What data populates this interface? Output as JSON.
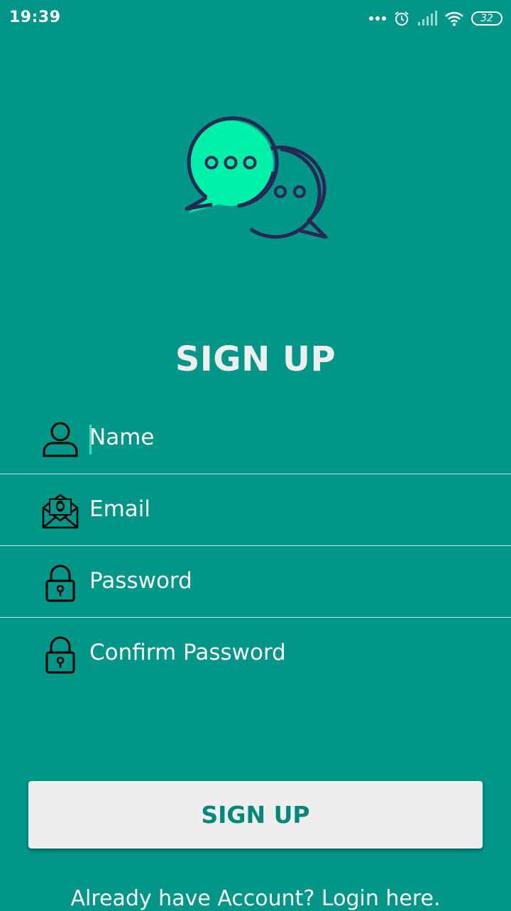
{
  "status_bar": {
    "time": "19:39",
    "battery": "32",
    "icons": [
      "more-dots-icon",
      "alarm-icon",
      "signal-icon",
      "wifi-icon",
      "battery-icon"
    ]
  },
  "logo": {
    "icon": "chat-bubbles-icon",
    "colors": {
      "accent": "#00f0a8",
      "stroke": "#2a2756"
    }
  },
  "title": "SIGN UP",
  "form": {
    "fields": [
      {
        "icon": "user-icon",
        "placeholder": "Name"
      },
      {
        "icon": "mail-icon",
        "placeholder": "Email"
      },
      {
        "icon": "lock-icon",
        "placeholder": "Password"
      },
      {
        "icon": "lock-icon",
        "placeholder": "Confirm Password"
      }
    ]
  },
  "signup_button": "SIGN UP",
  "login_link": "Already have Account? Login here.",
  "colors": {
    "background": "#009688",
    "button_bg": "#eeeeee",
    "button_text": "#00897b"
  }
}
